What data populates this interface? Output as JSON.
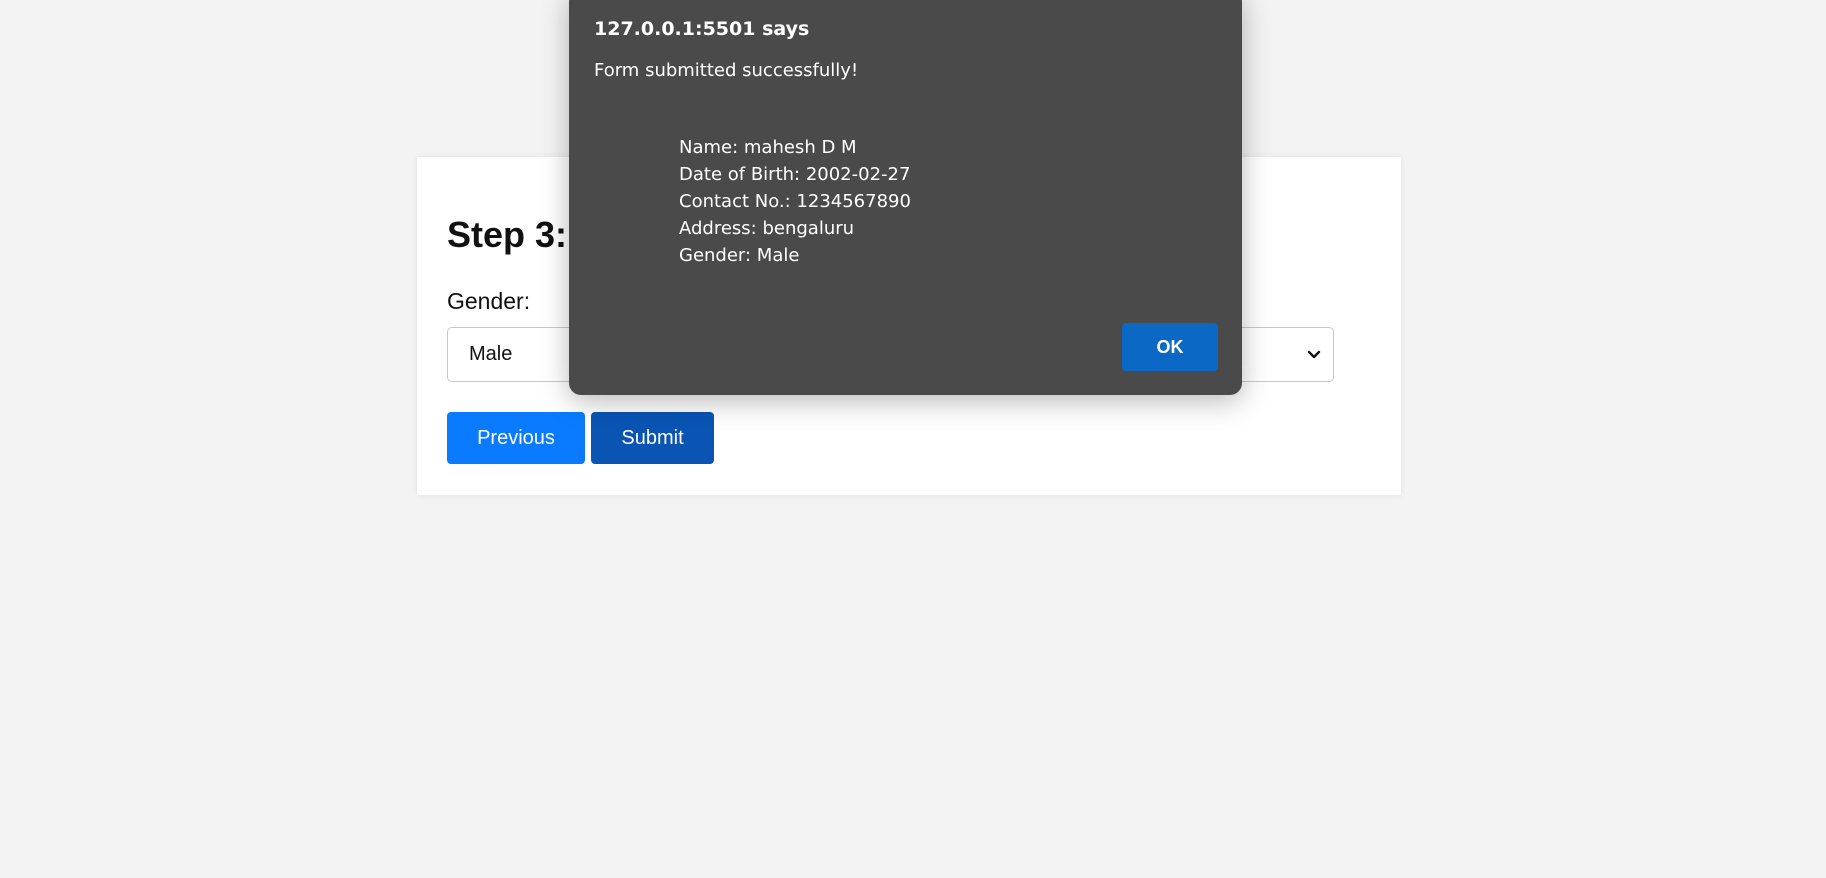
{
  "form": {
    "step_title": "Step 3:",
    "gender_label": "Gender:",
    "gender_selected": "Male",
    "previous_label": "Previous",
    "submit_label": "Submit"
  },
  "dialog": {
    "title": "127.0.0.1:5501 says",
    "message": "Form submitted successfully!",
    "details": [
      "Name: mahesh D M",
      "Date of Birth: 2002-02-27",
      "Contact No.: 1234567890",
      "Address: bengaluru",
      "Gender: Male"
    ],
    "ok_label": "OK"
  },
  "icons": {
    "select_arrow": "chevron-down-icon"
  },
  "colors": {
    "page_background": "#f3f3f3",
    "previous_button": "#0a7bff",
    "submit_button": "#0a55b4",
    "dialog_background": "#4a4a4a",
    "ok_button": "#0b68c4"
  }
}
